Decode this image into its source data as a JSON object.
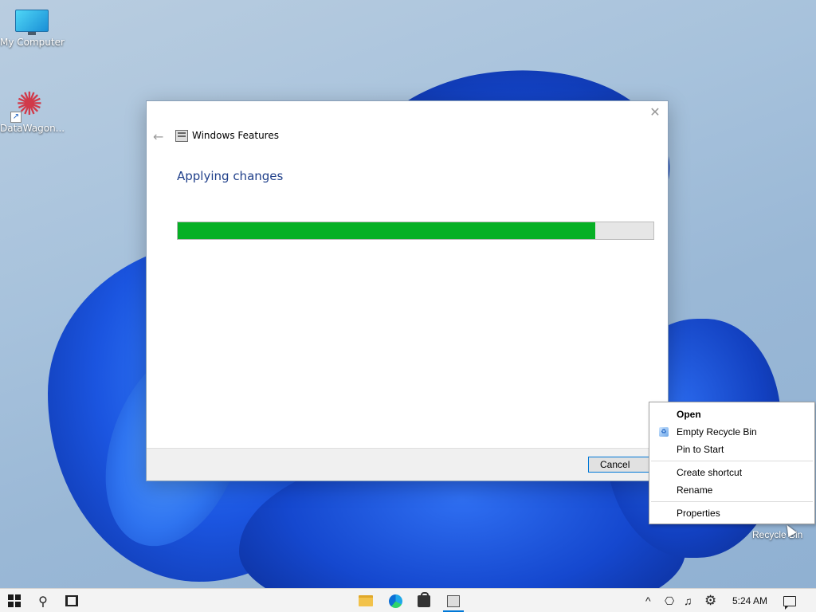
{
  "desktop": {
    "icons": [
      {
        "label": "My Computer"
      },
      {
        "label": "DataWagon..."
      }
    ],
    "recycle_bin_label": "Recycle Bin"
  },
  "dialog": {
    "back_glyph": "←",
    "close_glyph": "✕",
    "title": "Windows Features",
    "heading": "Applying changes",
    "progress_fraction": 0.877,
    "progress_color": "#06b025",
    "cancel_label": "Cancel"
  },
  "context_menu": {
    "items": [
      {
        "label": "Open",
        "default": true
      },
      {
        "label": "Empty Recycle Bin",
        "icon": "recycle-bin-icon"
      },
      {
        "label": "Pin to Start"
      },
      {
        "label": "Create shortcut"
      },
      {
        "label": "Rename"
      },
      {
        "label": "Properties"
      }
    ]
  },
  "taskbar": {
    "search_glyph": "⚲",
    "tray": {
      "chevron_glyph": "^",
      "network_glyph": "⎔",
      "volume_glyph": "♫",
      "settings_glyph": "⚙",
      "clock": "5:24 AM"
    }
  }
}
